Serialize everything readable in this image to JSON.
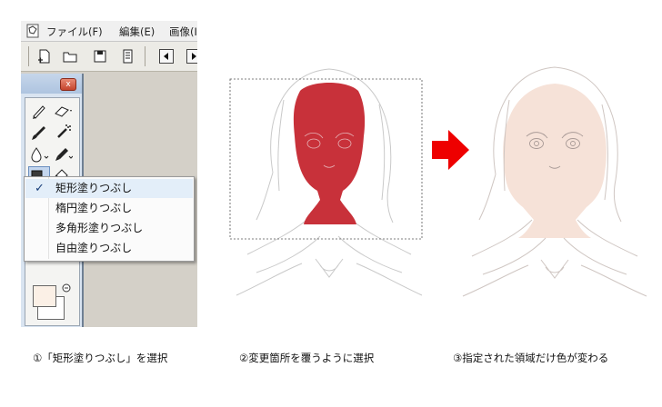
{
  "menubar": {
    "items": [
      "ファイル(F)",
      "編集(E)",
      "画像(I"
    ]
  },
  "toolbar": {
    "buttons": [
      "new-document-icon",
      "open-folder-icon",
      "save-icon",
      "save-all-icon",
      "prev-icon",
      "next-icon"
    ]
  },
  "palette": {
    "close_label": "x",
    "tools": [
      "pencil-icon",
      "eraser-icon",
      "brush-icon",
      "airbrush-icon",
      "water-drop-icon",
      "pen-icon",
      "fill-tool-icon",
      "bucket-icon"
    ],
    "colors": {
      "foreground": "#fbf0e6",
      "background": "#ffffff"
    }
  },
  "flyout": {
    "check": "✓",
    "items": [
      "矩形塗りつぶし",
      "楕円塗りつぶし",
      "多角形塗りつぶし",
      "自由塗りつぶし"
    ],
    "selected_index": 0
  },
  "colors": {
    "selection_fill": "#c8313a",
    "tinted_fill": "#f6e2d8",
    "arrow": "#ee0000"
  },
  "captions": {
    "step1": "①「矩形塗りつぶし」を選択",
    "step2": "②変更箇所を覆うように選択",
    "step3": "③指定された領域だけ色が変わる"
  }
}
